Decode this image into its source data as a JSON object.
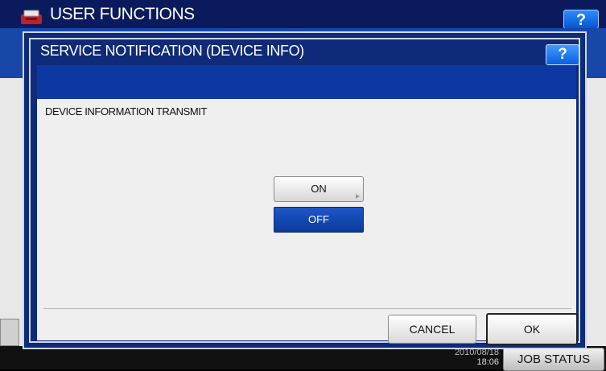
{
  "app": {
    "title": "USER FUNCTIONS",
    "help_label": "?"
  },
  "dialog": {
    "title": "SERVICE NOTIFICATION (DEVICE INFO)",
    "help_label": "?",
    "section_label": "DEVICE INFORMATION TRANSMIT",
    "options": [
      {
        "label": "ON",
        "selected": false
      },
      {
        "label": "OFF",
        "selected": true
      }
    ],
    "cancel_label": "CANCEL",
    "ok_label": "OK"
  },
  "status_bar": {
    "date": "2010/08/18",
    "time": "18:06",
    "job_status_label": "JOB STATUS"
  },
  "colors": {
    "header_bg": "#0a1a5c",
    "dialog_band": "#0d38a2",
    "selected_option": "#1347b5",
    "help_button": "#0a6ff0"
  },
  "icons": {
    "app_icon": "copier-icon",
    "help_icon": "question-mark-icon"
  }
}
